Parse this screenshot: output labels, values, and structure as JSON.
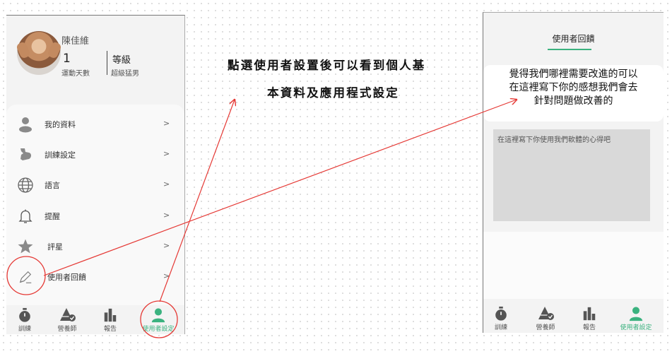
{
  "profile": {
    "name": "陳佳維",
    "days_value": "1",
    "days_caption": "運動天數",
    "level_label": "等級",
    "level_value": "超級猛男"
  },
  "menu": [
    {
      "label": "我的資料",
      "arrow": ">",
      "icon": "person-icon"
    },
    {
      "label": "訓練設定",
      "arrow": ">",
      "icon": "muscle-arm-icon"
    },
    {
      "label": "語言",
      "arrow": ">",
      "icon": "globe-icon"
    },
    {
      "label": "提醒",
      "arrow": ">",
      "icon": "bell-icon"
    },
    {
      "label": "評星",
      "arrow": ">",
      "icon": "star-icon"
    },
    {
      "label": "使用者回饋",
      "arrow": ">",
      "icon": "pencil-icon"
    }
  ],
  "nav": [
    {
      "label": "訓練",
      "icon": "stopwatch-icon"
    },
    {
      "label": "營養師",
      "icon": "pyramid-check-icon"
    },
    {
      "label": "報告",
      "icon": "bar-chart-icon"
    },
    {
      "label": "使用者設定",
      "icon": "user-icon",
      "active": true
    }
  ],
  "annotation": {
    "line1": "點選使用者設置後可以看到個人基",
    "line2": "本資料及應用程式設定"
  },
  "feedback": {
    "title": "使用者回饋",
    "question_line1": "覺得我們哪裡需要改進的可以",
    "question_line2": "在這裡寫下你的感想我們會去",
    "question_line3": "針對問題做改善的",
    "placeholder": "在這裡寫下你使用我們軟體的心得吧"
  },
  "colors": {
    "accent": "#3bb27f",
    "annotation_red": "#e53935"
  }
}
